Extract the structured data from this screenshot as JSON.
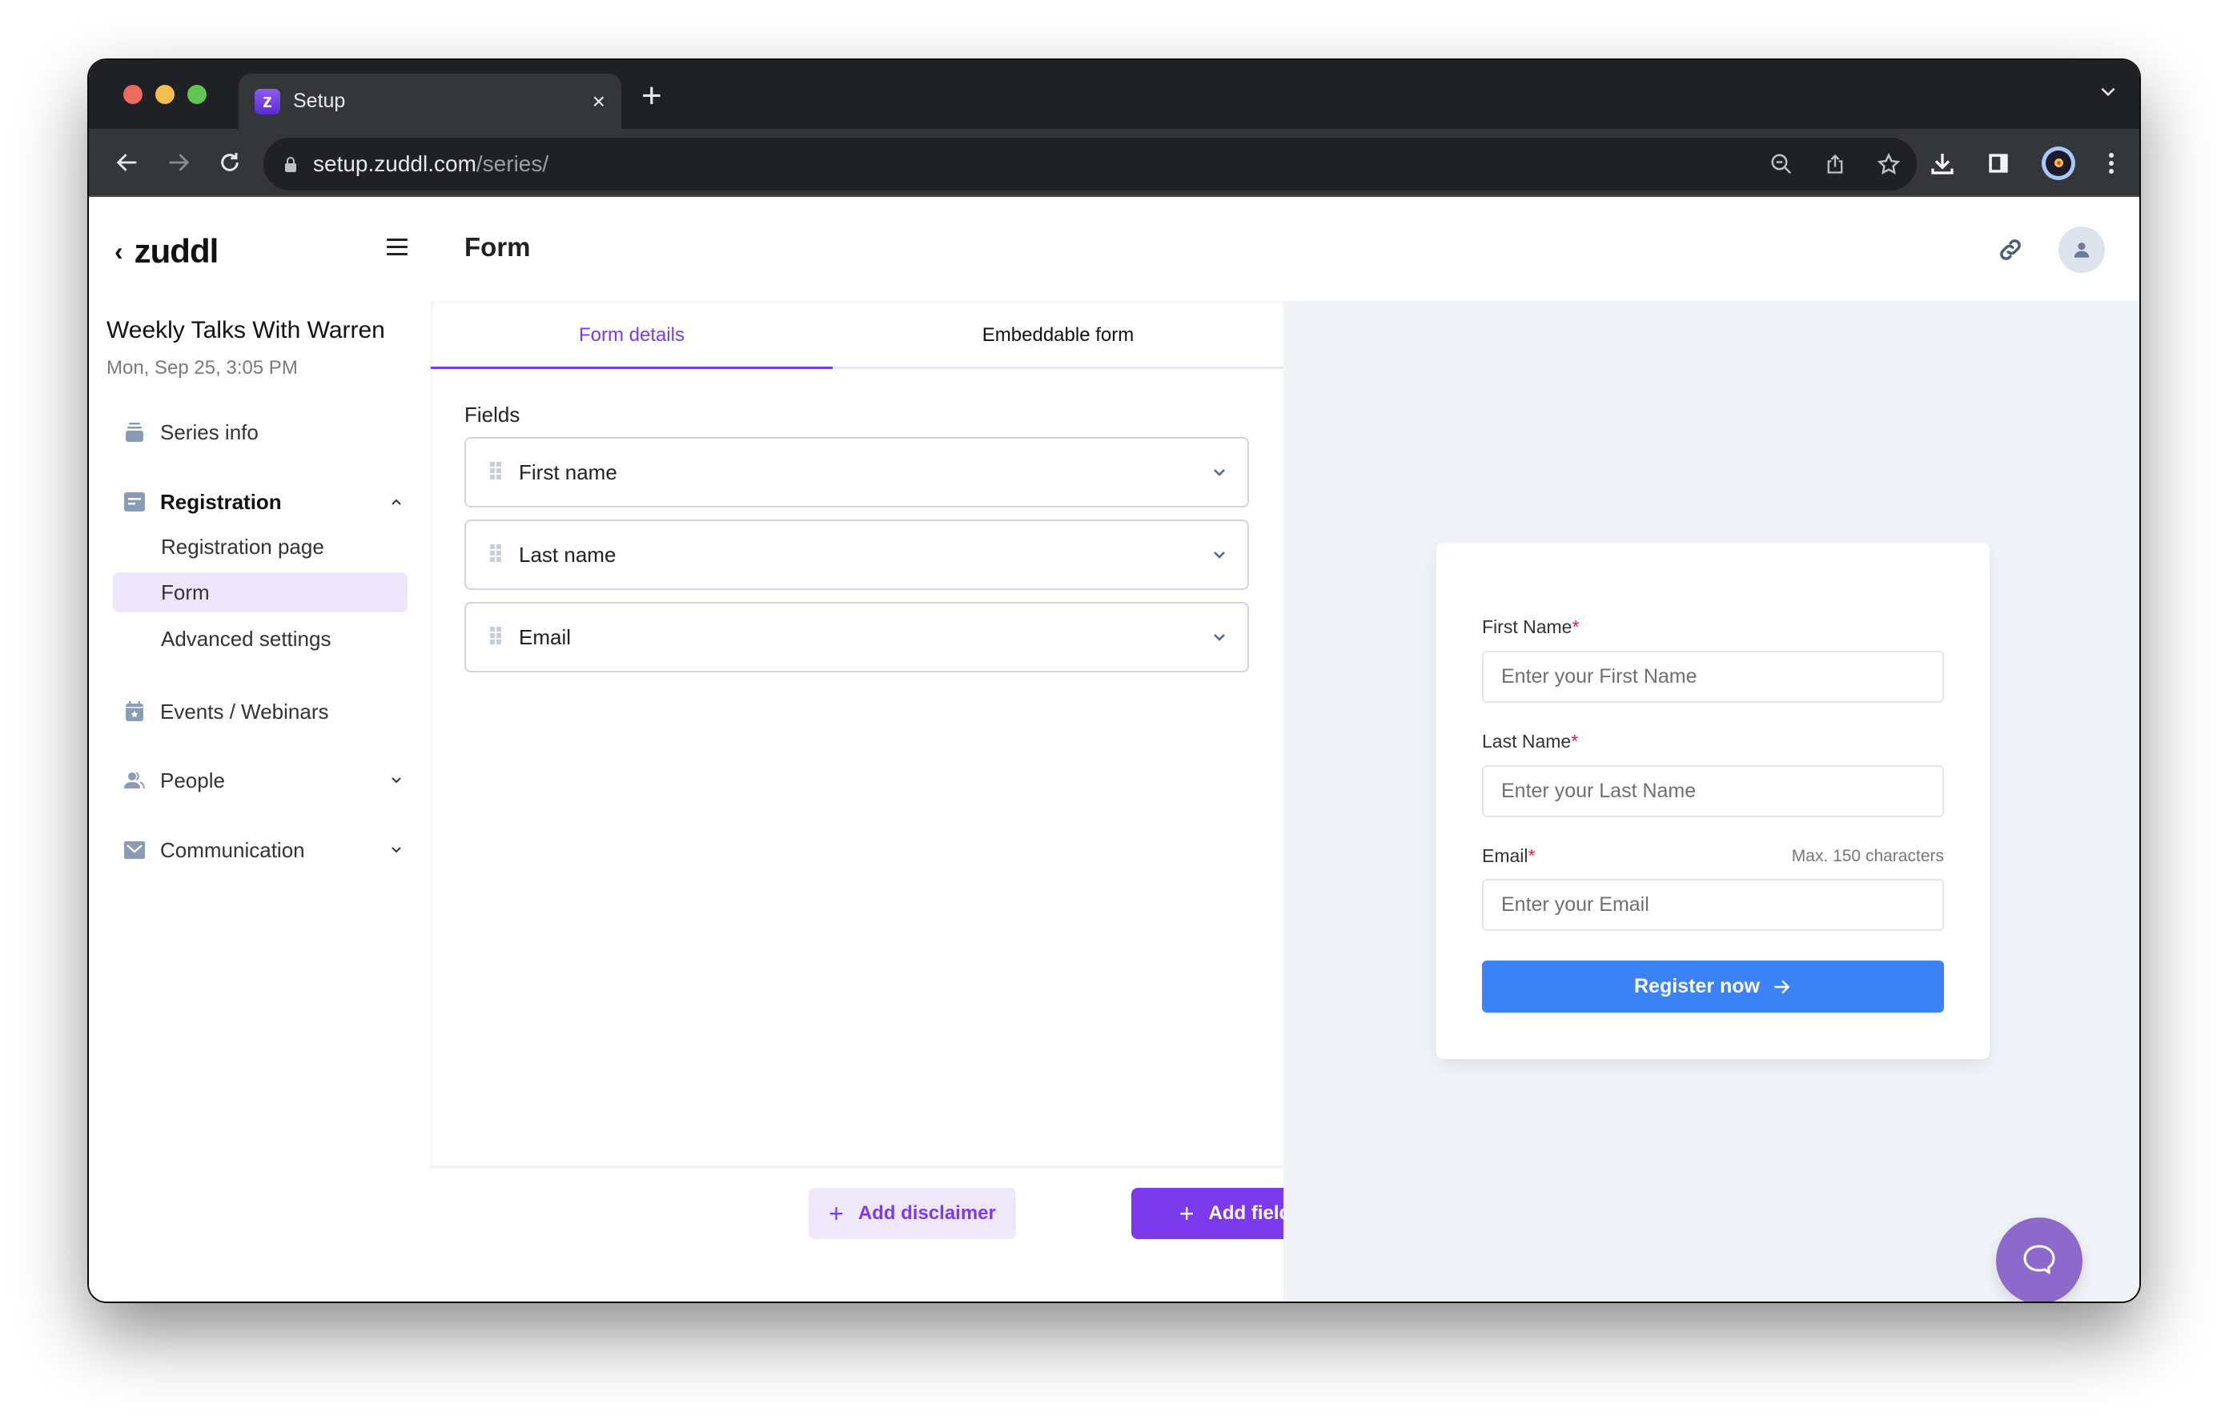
{
  "browser": {
    "tab": {
      "title": "Setup",
      "favicon_letter": "z"
    },
    "url": {
      "host": "setup.zuddl.com",
      "path": "/series/"
    },
    "icons": [
      "back-icon",
      "forward-icon",
      "reload-icon",
      "lock-icon",
      "zoom-out-icon",
      "share-icon",
      "bookmark-star-icon",
      "download-icon",
      "side-panel-icon",
      "profile-avatar",
      "kebab-menu-icon",
      "tab-list-chevron-icon"
    ]
  },
  "header": {
    "logo": "zuddl",
    "page_title": "Form"
  },
  "sidebar": {
    "series_title": "Weekly Talks With Warren",
    "series_date": "Mon, Sep 25, 3:05 PM",
    "items": [
      {
        "label": "Series info",
        "icon": "series-info-icon"
      },
      {
        "label": "Registration",
        "icon": "registration-icon",
        "expanded": true,
        "children": [
          {
            "label": "Registration page"
          },
          {
            "label": "Form",
            "active": true
          },
          {
            "label": "Advanced settings"
          }
        ]
      },
      {
        "label": "Events / Webinars",
        "icon": "calendar-star-icon"
      },
      {
        "label": "People",
        "icon": "people-icon",
        "expanded": false
      },
      {
        "label": "Communication",
        "icon": "mail-icon",
        "expanded": false
      }
    ]
  },
  "editor": {
    "tabs": [
      {
        "label": "Form details",
        "active": true
      },
      {
        "label": "Embeddable form",
        "active": false
      }
    ],
    "fields_label": "Fields",
    "fields": [
      {
        "name": "First name"
      },
      {
        "name": "Last name"
      },
      {
        "name": "Email"
      }
    ],
    "buttons": {
      "add_disclaimer": "Add disclaimer",
      "add_field": "Add field"
    }
  },
  "preview": {
    "fields": [
      {
        "label": "First Name",
        "required_mark": "*",
        "placeholder": "Enter your First Name",
        "hint": ""
      },
      {
        "label": "Last Name",
        "required_mark": "*",
        "placeholder": "Enter your Last Name",
        "hint": ""
      },
      {
        "label": "Email",
        "required_mark": "*",
        "placeholder": "Enter your Email",
        "hint": "Max. 150 characters"
      }
    ],
    "submit_label": "Register now"
  },
  "colors": {
    "accent": "#7c3aed",
    "accent_light": "#efe8fb",
    "submit": "#3b82f6",
    "chat_fab": "#8e69cc",
    "required": "#e11d48"
  }
}
